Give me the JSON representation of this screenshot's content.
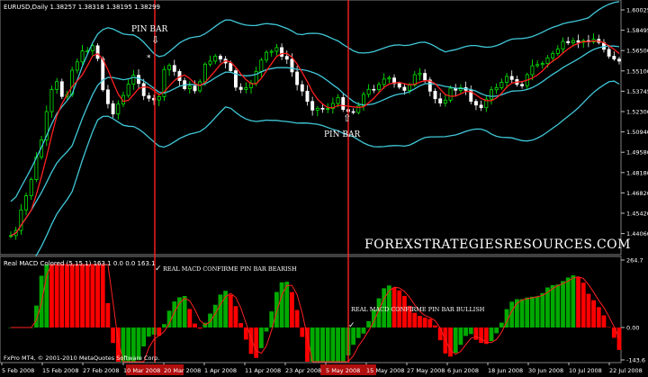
{
  "main_panel": {
    "header": "EURUSD,Daily  1.38257 1.38318 1.38195 1.38299",
    "price_ticks": [
      "1.60025",
      "1.58495",
      "1.56500",
      "1.55100",
      "1.53745",
      "1.52300",
      "1.50940",
      "1.49580",
      "1.48180",
      "1.46820",
      "1.45420",
      "1.44060"
    ],
    "watermark": "FOREXSTRATEGIESRESOURCES.COM",
    "annotation_top": "PIN BAR",
    "annotation_bottom": "PIN BAR"
  },
  "sub_panel": {
    "header": "Real MACD Colored (5,15,1) 163.1 0.0 0.0 163.1",
    "ticks": [
      "264.7",
      "0.00",
      "-143.6"
    ],
    "annotation_bearish": "REAL MACD CONFIRME PIN BAR BEARISH",
    "annotation_bullish": "REAL MACD CONFIRME PIN BAR BULLISH",
    "copyright": "FxPro MT4, © 2001-2010 MetaQuotes Software Corp."
  },
  "time_axis": {
    "labels": [
      "5 Feb 2008",
      "15 Feb 2008",
      "27 Feb 2008",
      "10 Mar 2008",
      "20 Mar 2008",
      "1 Apr 2008",
      "11 Apr 2008",
      "23 Apr 2008",
      "5 May 2008",
      "15 May 2008",
      "27 May 2008",
      "6 Jun 2008",
      "18 Jun 2008",
      "30 Jun 2008",
      "10 Jul 2008",
      "22 Jul 2008"
    ]
  },
  "colors": {
    "background": "#000000",
    "bull_candle": "#00ff00",
    "bear_candle": "#ffffff",
    "band": "#40c8d8",
    "ema_red": "#ff2020",
    "ema_cyan": "#40c8d8",
    "signal_line": "#ff2020",
    "hist_up": "#00aa00",
    "hist_down": "#ff0000"
  }
}
